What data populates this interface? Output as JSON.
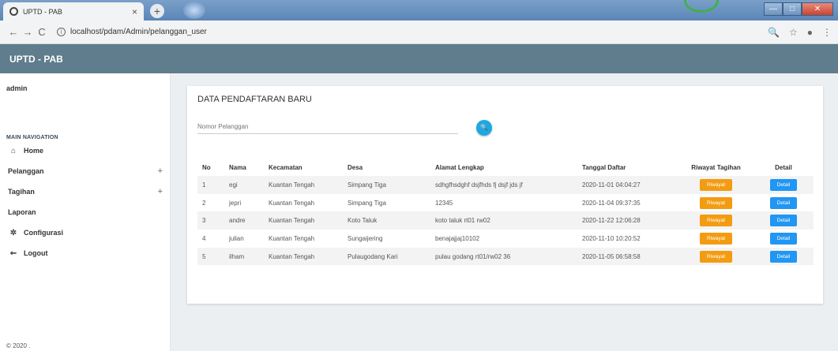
{
  "browser": {
    "tab_title": "UPTD - PAB",
    "tab_close": "×",
    "new_tab": "+",
    "url": "localhost/pdam/Admin/pelanggan_user",
    "back": "←",
    "forward": "→",
    "reload": "C",
    "info": "i",
    "zoom": "🔍",
    "star": "☆",
    "account": "●",
    "menu": "⋮",
    "minimize": "—",
    "maximize": "□",
    "close": "✕"
  },
  "header": {
    "app_title": "UPTD - PAB"
  },
  "sidebar": {
    "user": "admin",
    "nav_header": "MAIN NAVIGATION",
    "items": [
      {
        "label": "Home",
        "icon": "home-icon",
        "glyph": "⌂",
        "plus": ""
      },
      {
        "label": "Pelanggan",
        "icon": "",
        "glyph": "",
        "plus": "+"
      },
      {
        "label": "Tagihan",
        "icon": "",
        "glyph": "",
        "plus": "+"
      },
      {
        "label": "Laporan",
        "icon": "",
        "glyph": "",
        "plus": ""
      },
      {
        "label": "Configurasi",
        "icon": "gear-icon",
        "glyph": "✲",
        "plus": ""
      },
      {
        "label": "Logout",
        "icon": "logout-icon",
        "glyph": "⇜",
        "plus": ""
      }
    ],
    "footer": "© 2020 ."
  },
  "main": {
    "card_title": "DATA PENDAFTARAN BARU",
    "search_placeholder": "Nomor Pelanggan",
    "search_btn": "🔍",
    "table": {
      "headers": [
        "No",
        "Nama",
        "Kecamatan",
        "Desa",
        "Alamat Lengkap",
        "Tanggal Daftar",
        "Riwayat Tagihan",
        "Detail"
      ],
      "rows": [
        {
          "no": "1",
          "nama": "egi",
          "kecamatan": "Kuantan Tengah",
          "desa": "Simpang Tiga",
          "alamat": "sdhgfhsdghf dsjfhds fj dsjf jds jf",
          "tanggal": "2020-11-01 04:04:27",
          "riwayat": "Riwayat",
          "detail": "Detail"
        },
        {
          "no": "2",
          "nama": "jepri",
          "kecamatan": "Kuantan Tengah",
          "desa": "Simpang Tiga",
          "alamat": "12345",
          "tanggal": "2020-11-04 09:37:35",
          "riwayat": "Riwayat",
          "detail": "Detail"
        },
        {
          "no": "3",
          "nama": "andre",
          "kecamatan": "Kuantan Tengah",
          "desa": "Koto Taluk",
          "alamat": "koto taluk rt01 rw02",
          "tanggal": "2020-11-22 12:06:28",
          "riwayat": "Riwayat",
          "detail": "Detail"
        },
        {
          "no": "4",
          "nama": "julian",
          "kecamatan": "Kuantan Tengah",
          "desa": "Sungaijering",
          "alamat": "benajajjaj10102",
          "tanggal": "2020-11-10 10:20:52",
          "riwayat": "Riwayat",
          "detail": "Detail"
        },
        {
          "no": "5",
          "nama": "ilham",
          "kecamatan": "Kuantan Tengah",
          "desa": "Pulaugodang Kari",
          "alamat": "pulau godang rt01/rw02 36",
          "tanggal": "2020-11-05 06:58:58",
          "riwayat": "Riwayat",
          "detail": "Detail"
        }
      ]
    }
  },
  "colors": {
    "header_bg": "#5f7d8c",
    "riwayat_btn": "#f39c12",
    "detail_btn": "#2196f3",
    "search_btn": "#1fa8e0"
  }
}
